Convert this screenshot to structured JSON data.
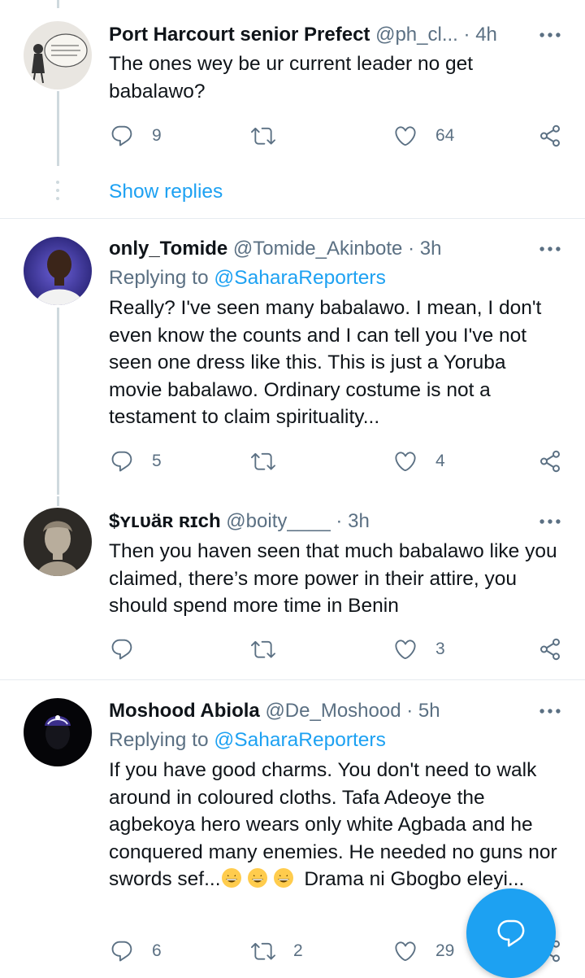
{
  "colors": {
    "accent": "#1da1f2",
    "secondary_text": "#5b7083",
    "divider": "#e6ecf0"
  },
  "icons": [
    "reply-icon",
    "retweet-icon",
    "like-icon",
    "share-icon",
    "more-icon",
    "compose-reply-icon"
  ],
  "tweets": [
    {
      "name": "Port Harcourt senior Prefect",
      "handle": "@ph_cl...",
      "time": "4h",
      "body": "The ones wey be ur current leader no get babalawo?",
      "replies": "9",
      "retweets": "",
      "likes": "64",
      "show_replies": "Show replies"
    },
    {
      "name": "only_Tomide",
      "handle": "@Tomide_Akinbote",
      "time": "3h",
      "replying_prefix": "Replying to",
      "replying_to": "@SaharaReporters",
      "body": "Really? I've seen many babalawo. I mean, I don't even know the counts and I can tell you I've not seen one dress like this. This is just a Yoruba movie babalawo. Ordinary costume is not a testament to claim spirituality...",
      "replies": "5",
      "retweets": "",
      "likes": "4"
    },
    {
      "name": "$ʏʟᴜӓʀ ʀɪcһ",
      "handle": "@boity____",
      "time": "3h",
      "body": "Then you haven seen that much babalawo like you claimed, there’s more power in their attire, you should spend more time in Benin",
      "replies": "",
      "retweets": "",
      "likes": "3"
    },
    {
      "name": "Moshood Abiola",
      "handle": "@De_Moshood",
      "time": "5h",
      "replying_prefix": "Replying to",
      "replying_to": "@SaharaReporters",
      "body_start": "If you have good charms. You don't need to walk around in coloured cloths. Tafa Adeoye the agbekoya hero wears only white Agbada and he conquered many enemies. He needed no guns nor swords sef...",
      "body_end": "Drama ni Gbogbo eleyi...",
      "replies": "6",
      "retweets": "2",
      "likes": "29"
    }
  ]
}
